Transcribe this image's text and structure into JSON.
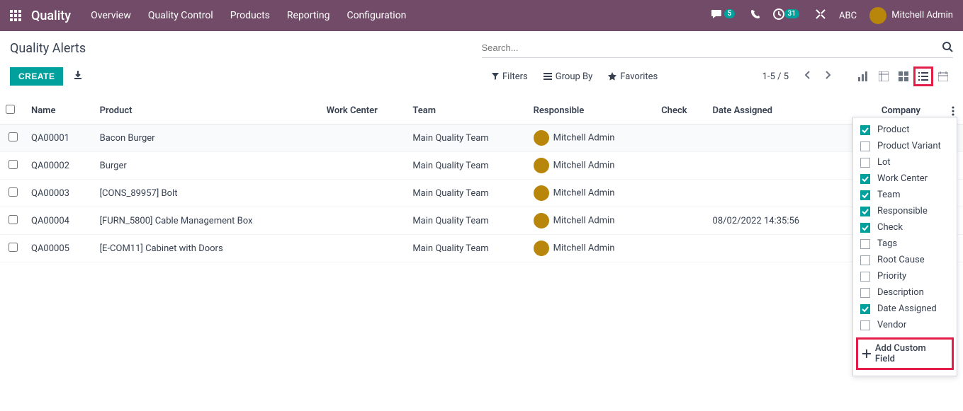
{
  "navbar": {
    "brand": "Quality",
    "links": [
      "Overview",
      "Quality Control",
      "Products",
      "Reporting",
      "Configuration"
    ],
    "msg_badge": "5",
    "sched_badge": "31",
    "company": "ABC",
    "user": "Mitchell Admin"
  },
  "page": {
    "title": "Quality Alerts",
    "search_placeholder": "Search...",
    "create_label": "CREATE",
    "filters_label": "Filters",
    "groupby_label": "Group By",
    "favorites_label": "Favorites",
    "pager": "1-5 / 5"
  },
  "columns": {
    "name": "Name",
    "product": "Product",
    "work_center": "Work Center",
    "team": "Team",
    "responsible": "Responsible",
    "check": "Check",
    "date_assigned": "Date Assigned",
    "company": "Company"
  },
  "rows": [
    {
      "name": "QA00001",
      "product": "Bacon Burger",
      "work_center": "",
      "team": "Main Quality Team",
      "responsible": "Mitchell Admin",
      "check": "",
      "date_assigned": "",
      "company": ""
    },
    {
      "name": "QA00002",
      "product": "Burger",
      "work_center": "",
      "team": "Main Quality Team",
      "responsible": "Mitchell Admin",
      "check": "",
      "date_assigned": "",
      "company": ""
    },
    {
      "name": "QA00003",
      "product": "[CONS_89957] Bolt",
      "work_center": "",
      "team": "Main Quality Team",
      "responsible": "Mitchell Admin",
      "check": "",
      "date_assigned": "",
      "company": ""
    },
    {
      "name": "QA00004",
      "product": "[FURN_5800] Cable Management Box",
      "work_center": "",
      "team": "Main Quality Team",
      "responsible": "Mitchell Admin",
      "check": "",
      "date_assigned": "08/02/2022 14:35:56",
      "company": ""
    },
    {
      "name": "QA00005",
      "product": "[E-COM11] Cabinet with Doors",
      "work_center": "",
      "team": "Main Quality Team",
      "responsible": "Mitchell Admin",
      "check": "",
      "date_assigned": "",
      "company": ""
    }
  ],
  "dropdown": {
    "items": [
      {
        "label": "Product",
        "checked": true
      },
      {
        "label": "Product Variant",
        "checked": false
      },
      {
        "label": "Lot",
        "checked": false
      },
      {
        "label": "Work Center",
        "checked": true
      },
      {
        "label": "Team",
        "checked": true
      },
      {
        "label": "Responsible",
        "checked": true
      },
      {
        "label": "Check",
        "checked": true
      },
      {
        "label": "Tags",
        "checked": false
      },
      {
        "label": "Root Cause",
        "checked": false
      },
      {
        "label": "Priority",
        "checked": false
      },
      {
        "label": "Description",
        "checked": false
      },
      {
        "label": "Date Assigned",
        "checked": true
      },
      {
        "label": "Vendor",
        "checked": false
      }
    ],
    "footer": "Add Custom Field"
  }
}
